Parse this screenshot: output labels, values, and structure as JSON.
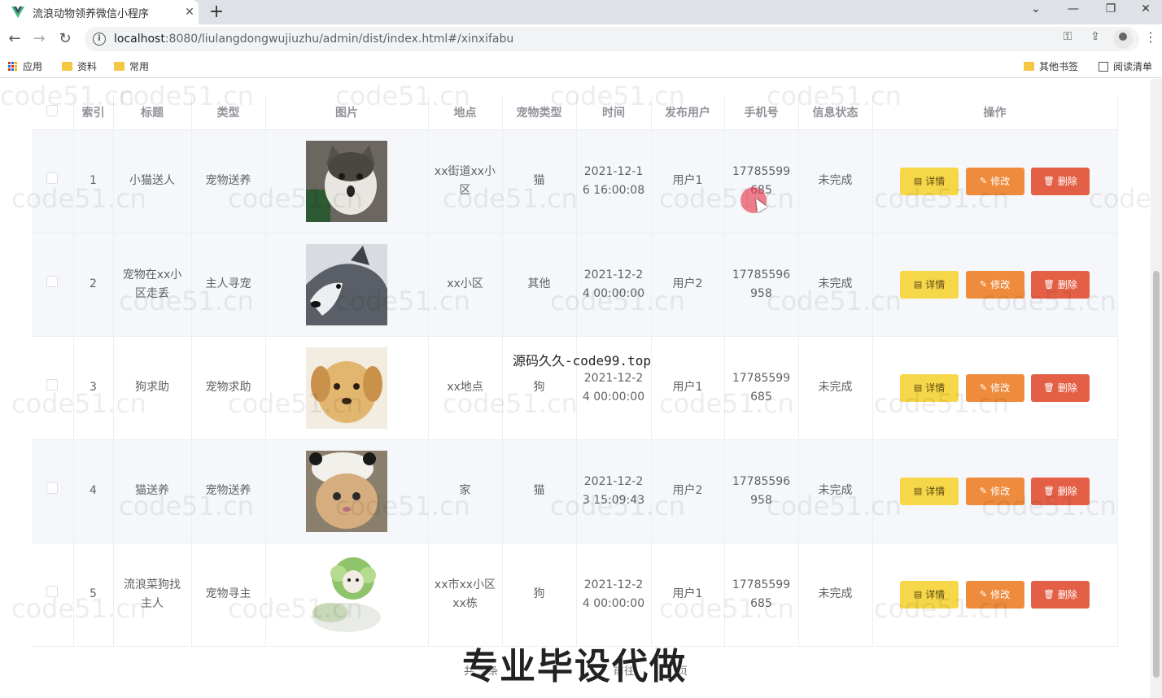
{
  "browser": {
    "tab_title": "流浪动物领养微信小程序",
    "tab_close": "✕",
    "new_tab": "+",
    "url_host": "localhost",
    "url_path": ":8080/liulangdongwujiuzhu/admin/dist/index.html#/xinxifabu",
    "bookmarks": [
      "应用",
      "资料",
      "常用"
    ],
    "other_bookmarks": "其他书签",
    "reading_list": "阅读清单"
  },
  "table": {
    "headers": [
      "",
      "索引",
      "标题",
      "类型",
      "图片",
      "地点",
      "宠物类型",
      "时间",
      "发布用户",
      "手机号",
      "信息状态",
      "操作"
    ],
    "rows": [
      {
        "index": "1",
        "title": "小猫送人",
        "type": "宠物送养",
        "location": "xx街道xx小区",
        "pet_type": "猫",
        "time": "2021-12-16 16:00:08",
        "user": "用户1",
        "phone": "17785599685",
        "status": "未完成"
      },
      {
        "index": "2",
        "title": "宠物在xx小区走丢",
        "type": "主人寻宠",
        "location": "xx小区",
        "pet_type": "其他",
        "time": "2021-12-24 00:00:00",
        "user": "用户2",
        "phone": "17785596958",
        "status": "未完成"
      },
      {
        "index": "3",
        "title": "狗求助",
        "type": "宠物求助",
        "location": "xx地点",
        "pet_type": "狗",
        "time": "2021-12-24 00:00:00",
        "user": "用户1",
        "phone": "17785599685",
        "status": "未完成"
      },
      {
        "index": "4",
        "title": "猫送养",
        "type": "宠物送养",
        "location": "家",
        "pet_type": "猫",
        "time": "2021-12-23 15:09:43",
        "user": "用户2",
        "phone": "17785596958",
        "status": "未完成"
      },
      {
        "index": "5",
        "title": "流浪菜狗找主人",
        "type": "宠物寻主",
        "location": "xx市xx小区xx栋",
        "pet_type": "狗",
        "time": "2021-12-24 00:00:00",
        "user": "用户1",
        "phone": "17785599685",
        "status": "未完成"
      }
    ],
    "actions": {
      "detail": "详情",
      "edit": "修改",
      "delete": "删除"
    }
  },
  "overlay": {
    "code_text": "源码久久-code99.top",
    "ad_text": "专业毕设代做",
    "watermark": "code51.cn",
    "pager_left": "共 5 条",
    "pager_mid": "前往",
    "pager_right": "页"
  },
  "colors": {
    "detail_button": "#f7d74a",
    "edit_button": "#ee8b3c",
    "delete_button": "#e36046",
    "stripe_row": "#f5f7fa"
  }
}
